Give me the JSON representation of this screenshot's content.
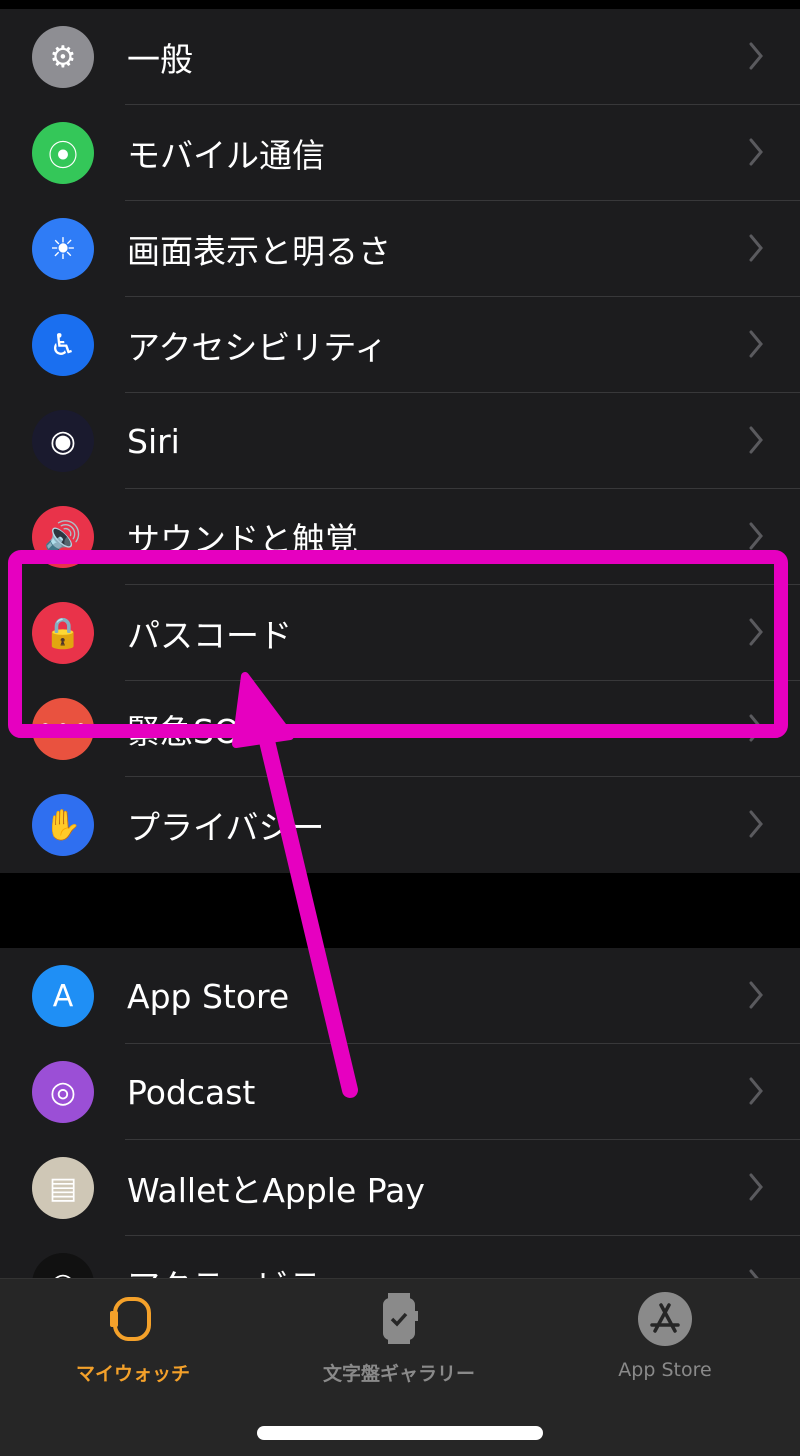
{
  "settings_group_1": [
    {
      "label": "一般",
      "icon": "gear-icon",
      "color": "#8e8e93"
    },
    {
      "label": "モバイル通信",
      "icon": "antenna-icon",
      "color": "#34c759"
    },
    {
      "label": "画面表示と明るさ",
      "icon": "sun-icon",
      "color": "#2f7cf6"
    },
    {
      "label": "アクセシビリティ",
      "icon": "accessibility-icon",
      "color": "#1a6ff0"
    },
    {
      "label": "Siri",
      "icon": "siri-icon",
      "color": "#1a1a2e"
    },
    {
      "label": "サウンドと触覚",
      "icon": "speaker-icon",
      "color": "#e9334a"
    },
    {
      "label": "パスコード",
      "icon": "lock-icon",
      "color": "#e9334a"
    },
    {
      "label": "緊急SOS",
      "icon": "sos-icon",
      "color": "#e9523f"
    },
    {
      "label": "プライバシー",
      "icon": "hand-icon",
      "color": "#2f6ff0"
    }
  ],
  "settings_group_2": [
    {
      "label": "App Store",
      "icon": "app-store-icon",
      "color": "#1f8ff5"
    },
    {
      "label": "Podcast",
      "icon": "podcast-icon",
      "color": "#9b4fd6"
    },
    {
      "label": "WalletとApple Pay",
      "icon": "wallet-icon",
      "color": "#cfc7b6"
    },
    {
      "label": "アクティビティ",
      "icon": "activity-rings-icon",
      "color": "#111"
    }
  ],
  "tabbar": {
    "tabs": [
      {
        "label": "マイウォッチ",
        "icon": "watch-icon",
        "active": true
      },
      {
        "label": "文字盤ギャラリー",
        "icon": "watch-face-icon",
        "active": false
      },
      {
        "label": "App Store",
        "icon": "app-store-icon",
        "active": false
      }
    ],
    "active_color": "#f4a12a",
    "inactive_color": "#8a8a8a"
  },
  "annotation": {
    "color": "#e600c0",
    "highlighted_item": "パスコード"
  }
}
